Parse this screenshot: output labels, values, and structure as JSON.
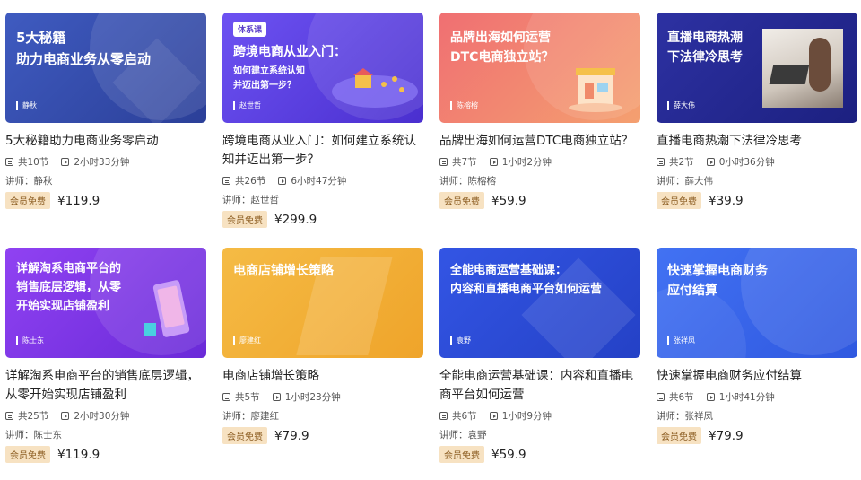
{
  "courses": [
    {
      "cover_lines": [
        "5大秘籍",
        "助力电商业务从零启动"
      ],
      "cover_tag": "",
      "cover_teacher": "静秋",
      "title": "5大秘籍助力电商业务零启动",
      "lessons": "共10节",
      "duration": "2小时33分钟",
      "teacher": "讲师：静秋",
      "badge": "会员免费",
      "price": "¥119.9",
      "colors": [
        "#3c56b8",
        "#2a3f96"
      ]
    },
    {
      "cover_lines": [
        "跨境电商从业入门：",
        "如何建立系统认知",
        "并迈出第一步？"
      ],
      "cover_tag": "体系课",
      "cover_teacher": "赵世哲",
      "title": "跨境电商从业入门：如何建立系统认知并迈出第一步？",
      "lessons": "共26节",
      "duration": "6小时47分钟",
      "teacher": "讲师：赵世哲",
      "badge": "会员免费",
      "price": "¥299.9",
      "colors": [
        "#6a4ff0",
        "#4b2ed0"
      ]
    },
    {
      "cover_lines": [
        "品牌出海如何运营",
        "DTC电商独立站？"
      ],
      "cover_tag": "",
      "cover_teacher": "陈榕榕",
      "title": "品牌出海如何运营DTC电商独立站？",
      "lessons": "共7节",
      "duration": "1小时2分钟",
      "teacher": "讲师：陈榕榕",
      "badge": "会员免费",
      "price": "¥59.9",
      "colors": [
        "#f07a6e",
        "#f39b6e"
      ]
    },
    {
      "cover_lines": [
        "直播电商热潮",
        "下法律冷思考"
      ],
      "cover_tag": "",
      "cover_teacher": "薛大伟",
      "title": "直播电商热潮下法律冷思考",
      "lessons": "共2节",
      "duration": "0小时36分钟",
      "teacher": "讲师：薛大伟",
      "badge": "会员免费",
      "price": "¥39.9",
      "colors": [
        "#2a2e9c",
        "#1d2280"
      ]
    },
    {
      "cover_lines": [
        "详解淘系电商平台的",
        "销售底层逻辑，从零",
        "开始实现店铺盈利"
      ],
      "cover_tag": "",
      "cover_teacher": "陈士东",
      "title": "详解淘系电商平台的销售底层逻辑，从零开始实现店铺盈利",
      "lessons": "共25节",
      "duration": "2小时30分钟",
      "teacher": "讲师：陈士东",
      "badge": "会员免费",
      "price": "¥119.9",
      "colors": [
        "#8a3ef0",
        "#6a2ad8"
      ]
    },
    {
      "cover_lines": [
        "电商店铺增长策略"
      ],
      "cover_tag": "",
      "cover_teacher": "廖建红",
      "title": "电商店铺增长策略",
      "lessons": "共5节",
      "duration": "1小时23分钟",
      "teacher": "讲师：廖建红",
      "badge": "会员免费",
      "price": "¥79.9",
      "colors": [
        "#f5b840",
        "#f0a52a"
      ]
    },
    {
      "cover_lines": [
        "全能电商运营基础课：",
        "内容和直播电商平台如何运营"
      ],
      "cover_tag": "",
      "cover_teacher": "袁野",
      "title": "全能电商运营基础课：内容和直播电商平台如何运营",
      "lessons": "共6节",
      "duration": "1小时9分钟",
      "teacher": "讲师：袁野",
      "badge": "会员免费",
      "price": "¥59.9",
      "colors": [
        "#3050e0",
        "#2540c8"
      ]
    },
    {
      "cover_lines": [
        "快速掌握电商财务",
        "应付结算"
      ],
      "cover_tag": "",
      "cover_teacher": "张祥凤",
      "title": "快速掌握电商财务应付结算",
      "lessons": "共6节",
      "duration": "1小时41分钟",
      "teacher": "讲师：张祥凤",
      "badge": "会员免费",
      "price": "¥79.9",
      "colors": [
        "#3f6ef2",
        "#2f58e0"
      ]
    }
  ]
}
